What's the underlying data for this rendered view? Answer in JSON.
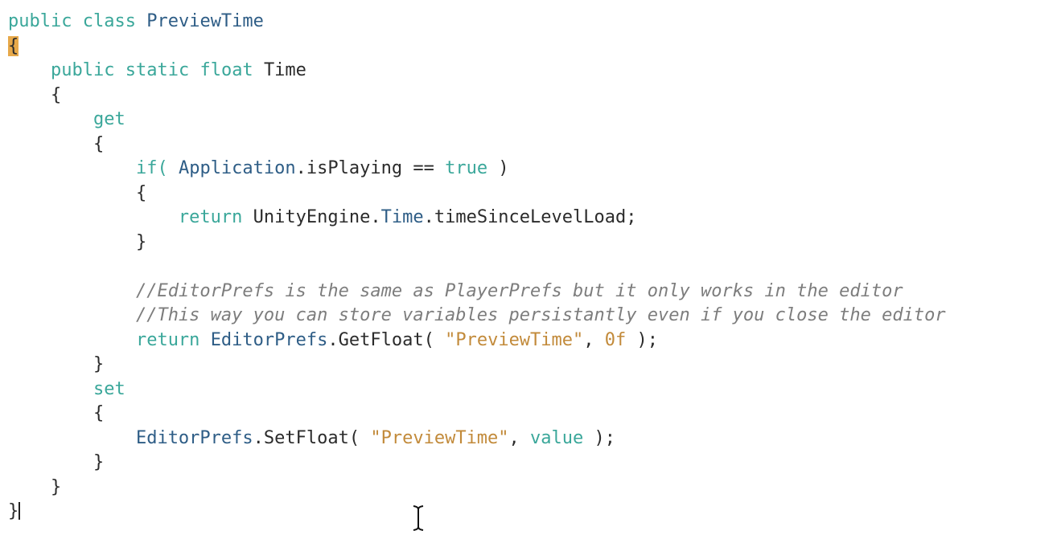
{
  "colors": {
    "background": "#ffffff",
    "keyword": "#3aa79a",
    "type": "#2e5d86",
    "comment": "#7d7d7d",
    "string": "#c28a3a",
    "brace_highlight": "#e7a94a"
  },
  "code": {
    "line1": {
      "t1": "public",
      "t2": "class",
      "t3": "PreviewTime"
    },
    "line2": {
      "t1": "{"
    },
    "line3": {
      "t1": "public",
      "t2": "static",
      "t3": "float",
      "t4": "Time"
    },
    "line4": {
      "t1": "{"
    },
    "line5": {
      "t1": "get"
    },
    "line6": {
      "t1": "{"
    },
    "line7": {
      "t1": "if(",
      "t2": "Application",
      "t3": ".isPlaying ==",
      "t4": "true",
      "t5": ")"
    },
    "line8": {
      "t1": "{"
    },
    "line9": {
      "t1": "return",
      "t2": "UnityEngine",
      "t3": ".",
      "t4": "Time",
      "t5": ".timeSinceLevelLoad;"
    },
    "line10": {
      "t1": "}"
    },
    "line12": {
      "t1": "//EditorPrefs is the same as PlayerPrefs but it only works in the editor"
    },
    "line13": {
      "t1": "//This way you can store variables persistantly even if you close the editor"
    },
    "line14": {
      "t1": "return",
      "t2": "EditorPrefs",
      "t3": ".GetFloat(",
      "t4": "\"PreviewTime\"",
      "t5": ",",
      "t6": "0f",
      "t7": ");"
    },
    "line15": {
      "t1": "}"
    },
    "line16": {
      "t1": "set"
    },
    "line17": {
      "t1": "{"
    },
    "line18": {
      "t1": "EditorPrefs",
      "t2": ".SetFloat(",
      "t3": "\"PreviewTime\"",
      "t4": ",",
      "t5": "value",
      "t6": ");"
    },
    "line19": {
      "t1": "}"
    },
    "line20": {
      "t1": "}"
    },
    "line21": {
      "t1": "}"
    }
  },
  "icons": {
    "cursor": "text-cursor-ibeam-icon"
  }
}
